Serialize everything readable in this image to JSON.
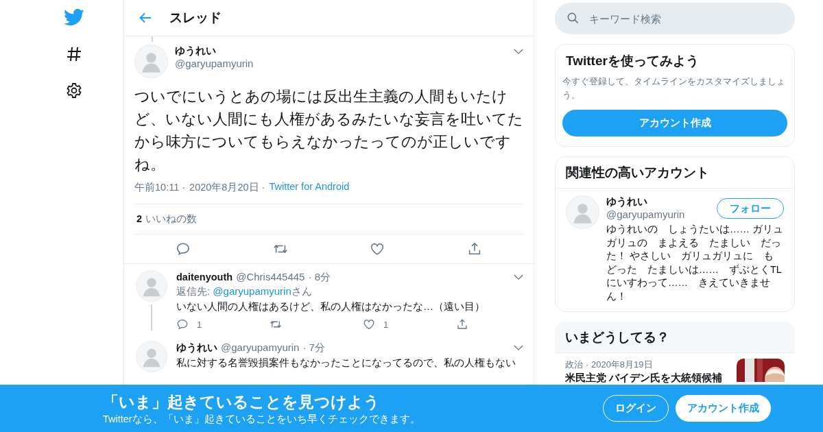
{
  "header": {
    "title": "スレッド"
  },
  "main_tweet": {
    "name": "ゆうれい",
    "handle": "@garyupamyurin",
    "text": "ついでにいうとあの場には反出生主義の人間もいたけど、いない人間にも人権があるみたいな妄言を吐いてたから味方についてもらえなかったってのが正しいですね。",
    "time": "午前10:11 ·",
    "date": "2020年8月20日 ·",
    "source": "Twitter for Android",
    "like_count": "2",
    "like_label": "いいねの数"
  },
  "replies": [
    {
      "name": "daitenyouth",
      "handle": "@Chris445445",
      "age": "· 8分",
      "reply_to_label": "返信先:",
      "reply_to_handle": "@garyupamyurin",
      "reply_to_suffix": "さん",
      "text": "いない人間の人権はあるけど、私の人権はなかったな…（遠い目）",
      "reply_count": "1",
      "like_count": "1"
    },
    {
      "name": "ゆうれい",
      "handle": "@garyupamyurin",
      "age": "· 7分",
      "text": "私に対する名誉毀損案件もなかったことになってるので、私の人権もない"
    }
  ],
  "search": {
    "placeholder": "キーワード検索"
  },
  "signup_card": {
    "title": "Twitterを使ってみよう",
    "text": "今すぐ登録して、タイムラインをカスタマイズしましょう。",
    "button": "アカウント作成"
  },
  "related": {
    "title": "関連性の高いアカウント",
    "user": {
      "name": "ゆうれい",
      "handle": "@garyupamyurin",
      "button": "フォロー",
      "bio": "ゆうれいの　しょうたいは…… ガリュガリュの　まよえる　たましい　だった！ やさしい　ガリュガリュに　もどった　たましいは……　ずぶとくTLにいすわって……　きえていきません！"
    }
  },
  "trends": {
    "title": "いまどうしてる？",
    "items": [
      {
        "category": "政治",
        "date": "· 2020年8月19日",
        "headline": "米民主党 バイデン氏を大統領候補",
        "kind": "picture"
      }
    ]
  },
  "banner": {
    "title": "「いま」起きていることを見つけよう",
    "subtitle": "Twitterなら、「いま」起きていることをいち早くチェックできます。",
    "login": "ログイン",
    "signup": "アカウント作成"
  }
}
